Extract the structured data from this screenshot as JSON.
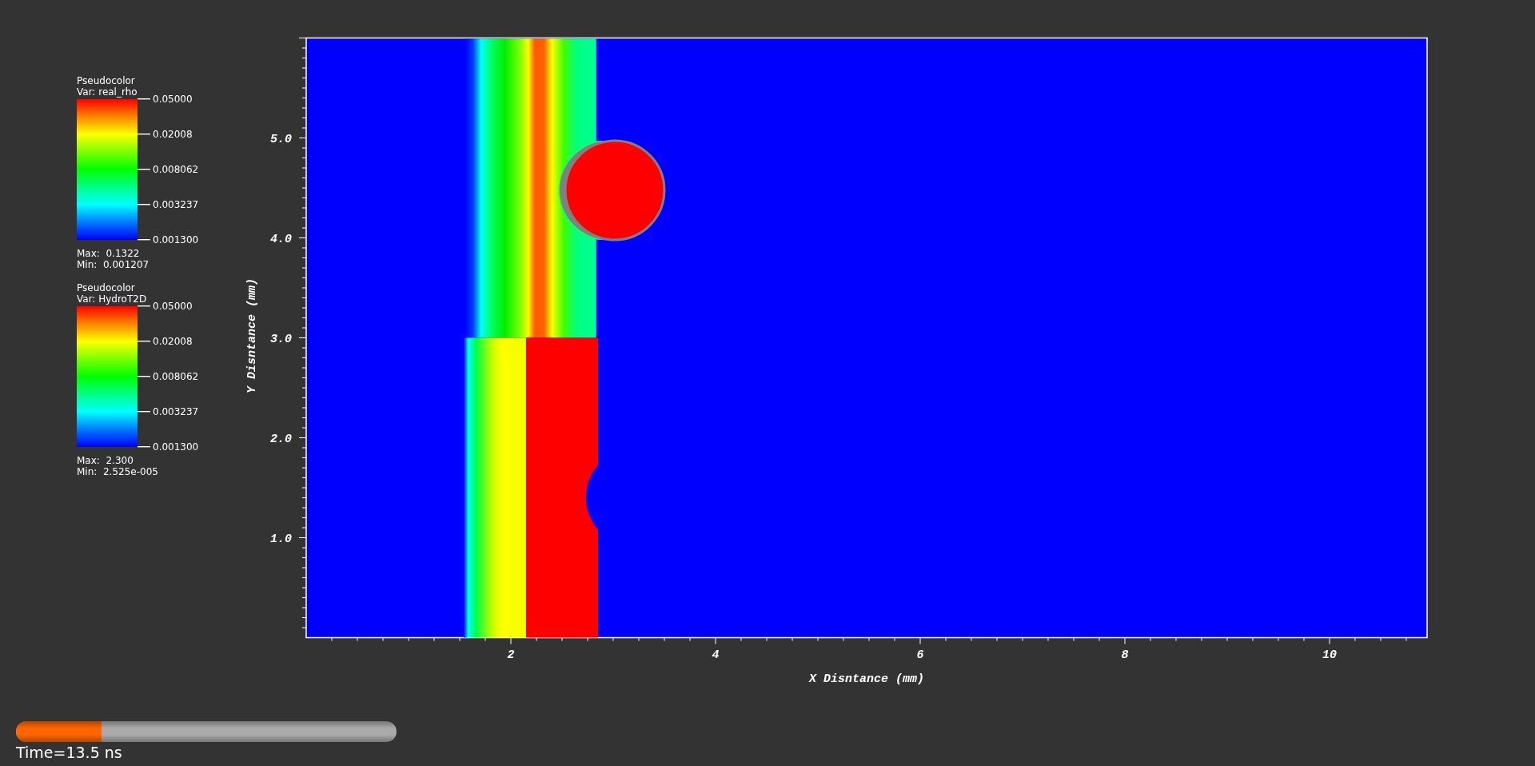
{
  "legends": [
    {
      "title": "Pseudocolor",
      "variable": "Var: real_rho",
      "ticks": [
        "0.05000",
        "0.02008",
        "0.008062",
        "0.003237",
        "0.001300"
      ],
      "max": "Max:  0.1322",
      "min": "Min:  0.001207"
    },
    {
      "title": "Pseudocolor",
      "variable": "Var: HydroT2D",
      "ticks": [
        "0.05000",
        "0.02008",
        "0.008062",
        "0.003237",
        "0.001300"
      ],
      "max": "Max:  2.300",
      "min": "Min:  2.525e-005"
    }
  ],
  "plot": {
    "x_axis": {
      "title": "X Disntance (mm)",
      "ticks": [
        "2",
        "4",
        "6",
        "8",
        "10"
      ]
    },
    "y_axis": {
      "title": "Y Disntance (mm)",
      "ticks": [
        "5.0",
        "4.0",
        "3.0",
        "2.0",
        "1.0"
      ]
    }
  },
  "time_slider": {
    "level": 0.225,
    "label": "Time=13.5 ns"
  }
}
